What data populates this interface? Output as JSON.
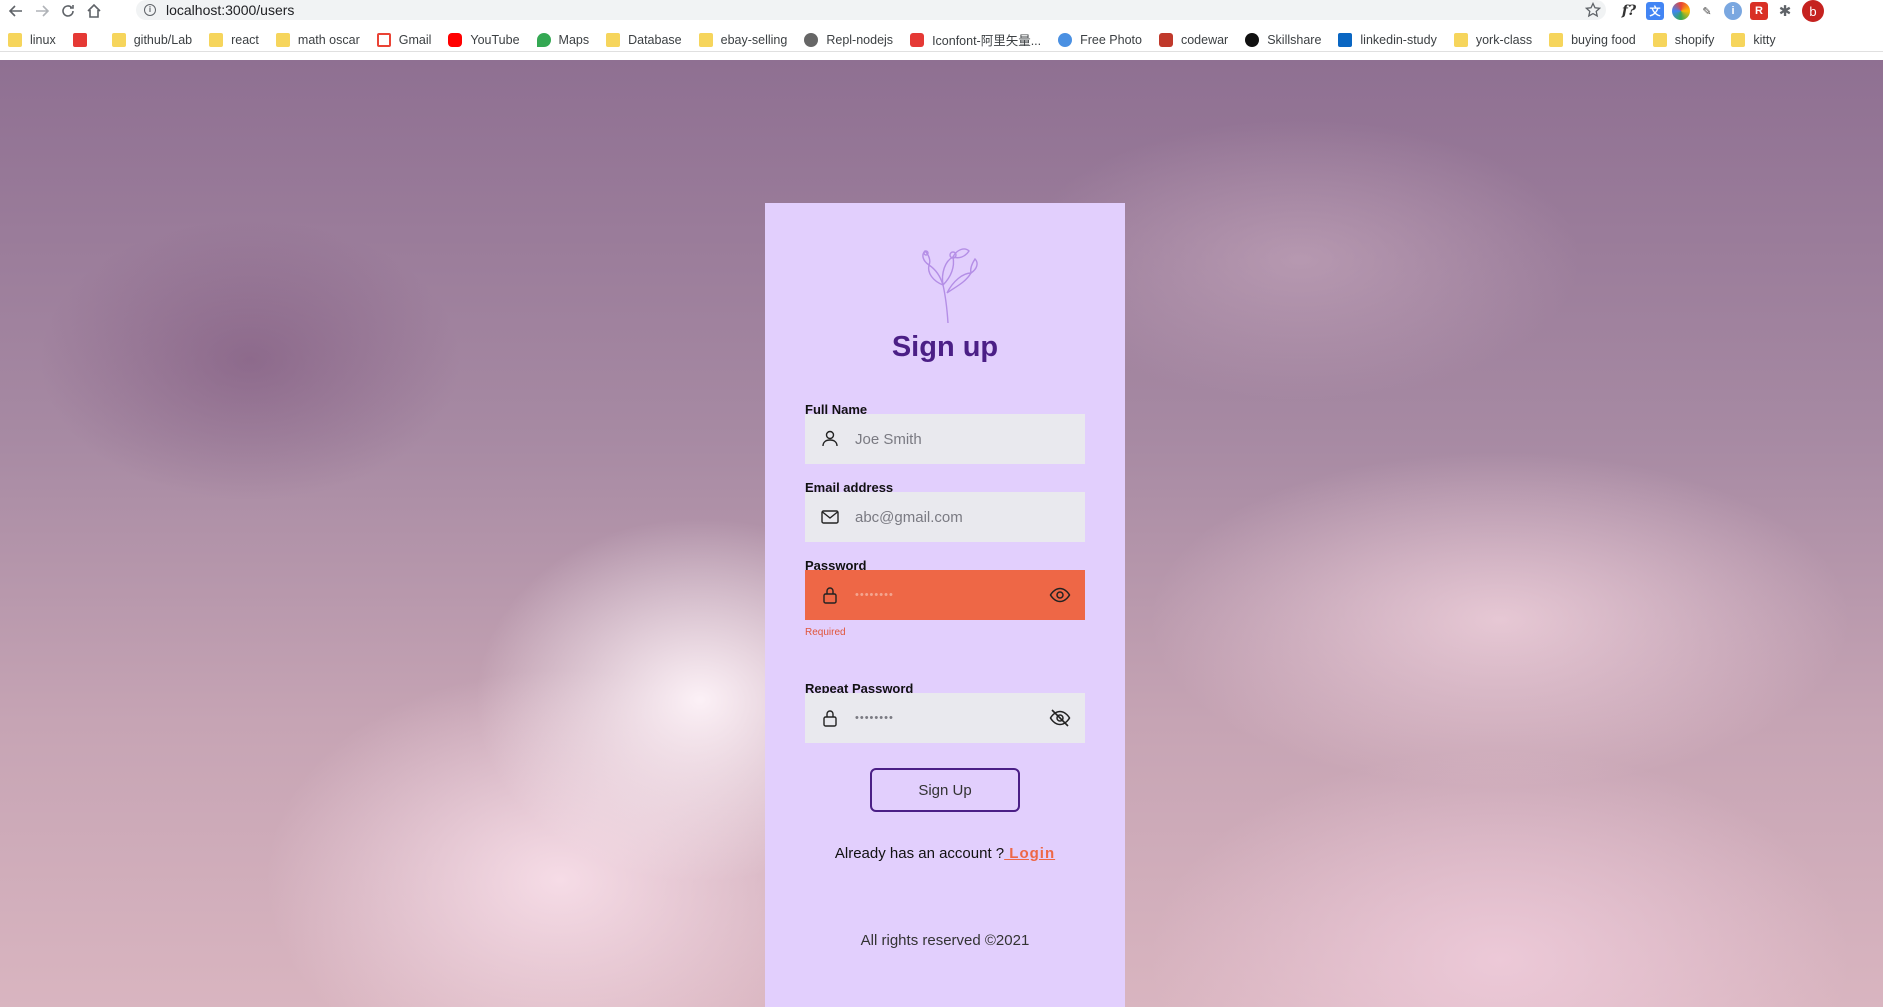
{
  "browser": {
    "url": "localhost:3000/users",
    "profile_initial": "b",
    "bookmarks": [
      {
        "label": "linux",
        "icon": "folder-icon"
      },
      {
        "label": "",
        "icon": "bookmark-red-icon"
      },
      {
        "label": "github/Lab",
        "icon": "folder-icon"
      },
      {
        "label": "react",
        "icon": "folder-icon"
      },
      {
        "label": "math oscar",
        "icon": "folder-icon"
      },
      {
        "label": "Gmail",
        "icon": "gmail-icon"
      },
      {
        "label": "YouTube",
        "icon": "youtube-icon"
      },
      {
        "label": "Maps",
        "icon": "maps-icon"
      },
      {
        "label": "Database",
        "icon": "folder-icon"
      },
      {
        "label": "ebay-selling",
        "icon": "folder-icon"
      },
      {
        "label": "Repl-nodejs",
        "icon": "repl-icon"
      },
      {
        "label": "Iconfont-阿里矢量...",
        "icon": "iconfont-icon"
      },
      {
        "label": "Free Photo",
        "icon": "free-photo-icon"
      },
      {
        "label": "codewar",
        "icon": "codewar-icon"
      },
      {
        "label": "Skillshare",
        "icon": "skillshare-icon"
      },
      {
        "label": "linkedin-study",
        "icon": "linkedin-icon"
      },
      {
        "label": "york-class",
        "icon": "folder-icon"
      },
      {
        "label": "buying food",
        "icon": "folder-icon"
      },
      {
        "label": "shopify",
        "icon": "folder-icon"
      },
      {
        "label": "kitty",
        "icon": "folder-icon"
      }
    ]
  },
  "form": {
    "title": "Sign up",
    "full_name": {
      "label": "Full Name",
      "placeholder": "Joe Smith"
    },
    "email": {
      "label": "Email address",
      "placeholder": "abc@gmail.com"
    },
    "password": {
      "label": "Password",
      "placeholder": "••••••••",
      "error": "Required"
    },
    "repeat_password": {
      "label": "Repeat Password",
      "placeholder": "••••••••"
    },
    "submit_label": "Sign Up",
    "login_prompt": "Already has an account ?",
    "login_link": " Login",
    "footer": "All rights reserved ©2021"
  },
  "colors": {
    "card_bg": "#e2cffd",
    "title": "#4b1f86",
    "error_field": "#ee6746",
    "link": "#ee6746"
  }
}
